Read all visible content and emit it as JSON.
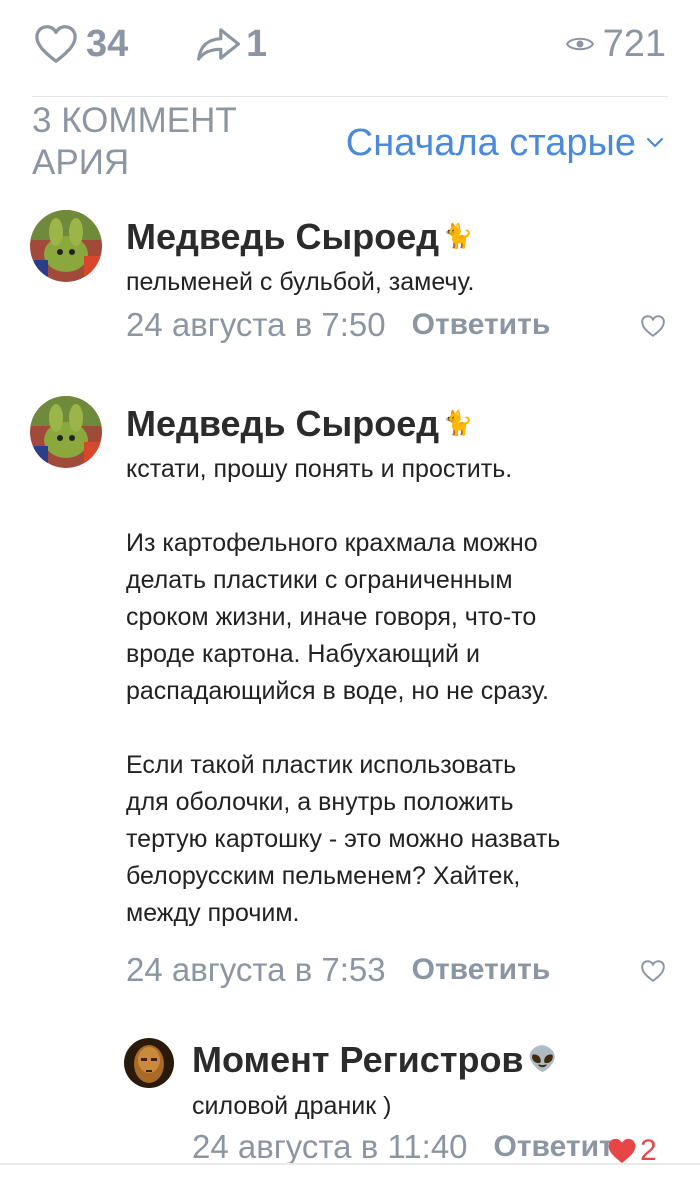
{
  "stats": {
    "likes": "34",
    "shares": "1",
    "views": "721"
  },
  "comments_header": {
    "count_label": "3 КОММЕНТАРИЯ",
    "count_line1": "3 КОММЕНТ",
    "count_line2": "АРИЯ",
    "sort_label": "Сначала старые"
  },
  "comments": [
    {
      "author": "Медведь Сыроед",
      "badge": "🐈",
      "text": "пельменей с бульбой, замечу.",
      "date": "24 августа в 7:50",
      "reply_label": "Ответить"
    },
    {
      "author": "Медведь Сыроед",
      "badge": "🐈",
      "text": "кстати, прошу понять и простить.\n\nИз картофельного крахмала можно\nделать пластики с ограниченным\nсроком жизни, иначе говоря, что-то\nвроде картона. Набухающий и\nраспадающийся в воде, но не сразу.\n\nЕсли такой пластик использовать\nдля оболочки, а внутрь положить\nтертую картошку - это можно назвать\nбелорусским пельменем? Хайтек,\nмежду прочим.",
      "date": "24 августа в 7:53",
      "reply_label": "Ответить"
    },
    {
      "author": "Момент Регистров",
      "badge": "👽",
      "text": "силовой драник )",
      "date": "24 августа в 11:40",
      "reply_label": "Ответить",
      "likes": "2"
    }
  ],
  "colors": {
    "accent": "#4a8ad8",
    "muted": "#8c96a3",
    "like_active": "#e64646"
  }
}
